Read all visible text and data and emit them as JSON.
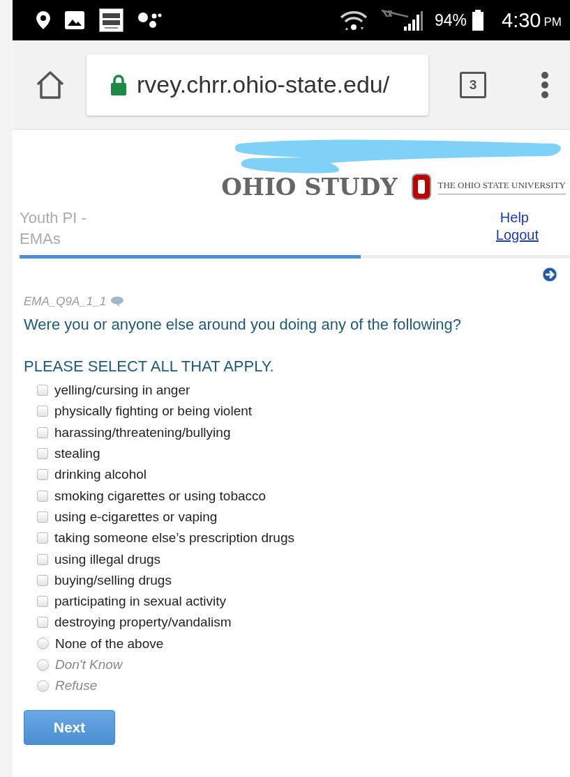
{
  "status_bar": {
    "battery": "94%",
    "time": "4:30",
    "meridiem": "PM"
  },
  "browser": {
    "url": "rvey.chrr.ohio-state.edu/",
    "tab_count": "3"
  },
  "header": {
    "study_title": "OHIO STUDY",
    "university": "THE OHIO STATE UNIVERSITY",
    "section": "Youth PI - EMAs",
    "links": [
      "Help",
      "Logout"
    ]
  },
  "progress": {
    "level": 0.62
  },
  "question": {
    "code": "EMA_Q9A_1_1",
    "text": "Were you or anyone else around you doing any of the following?",
    "instruction": "PLEASE SELECT ALL THAT APPLY.",
    "options": [
      {
        "label": "yelling/cursing in anger",
        "kind": "checkbox",
        "checked": false
      },
      {
        "label": "physically fighting or being violent",
        "kind": "checkbox",
        "checked": false
      },
      {
        "label": "harassing/threatening/bullying",
        "kind": "checkbox",
        "checked": false
      },
      {
        "label": "stealing",
        "kind": "checkbox",
        "checked": false
      },
      {
        "label": "drinking alcohol",
        "kind": "checkbox",
        "checked": false
      },
      {
        "label": "smoking cigarettes or using tobacco",
        "kind": "checkbox",
        "checked": false
      },
      {
        "label": "using e-cigarettes or vaping",
        "kind": "checkbox",
        "checked": false
      },
      {
        "label": "taking someone else’s prescription drugs",
        "kind": "checkbox",
        "checked": false
      },
      {
        "label": "using illegal drugs",
        "kind": "checkbox",
        "checked": false
      },
      {
        "label": "buying/selling drugs",
        "kind": "checkbox",
        "checked": false
      },
      {
        "label": "participating in sexual activity",
        "kind": "checkbox",
        "checked": false
      },
      {
        "label": "destroying property/vandalism",
        "kind": "checkbox",
        "checked": false
      },
      {
        "label": "None of the above",
        "kind": "radio",
        "checked": false
      },
      {
        "label": "Don't Know",
        "kind": "nonresponse",
        "checked": false
      },
      {
        "label": "Refuse",
        "kind": "nonresponse",
        "checked": false
      }
    ]
  },
  "next_button": "Next"
}
